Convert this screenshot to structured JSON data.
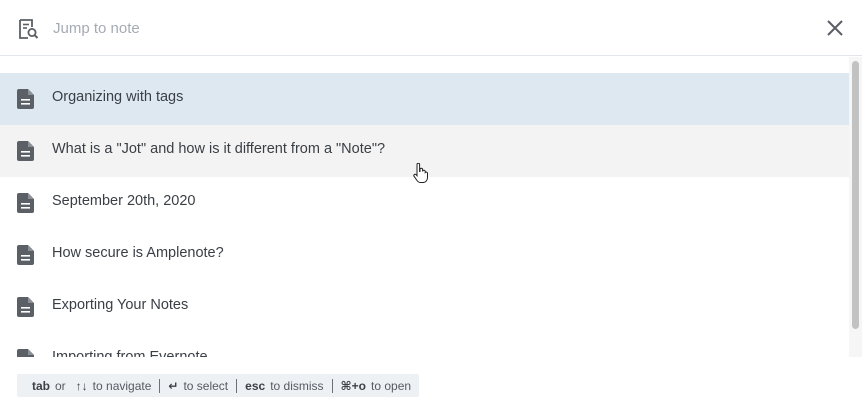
{
  "search": {
    "placeholder": "Jump to note",
    "value": ""
  },
  "icons": {
    "search": "note-search-icon",
    "close": "close-icon",
    "note": "document-icon"
  },
  "notes": [
    {
      "title": "Organizing with tags",
      "state": "selected"
    },
    {
      "title": "What is a \"Jot\" and how is it different from a \"Note\"?",
      "state": "hover"
    },
    {
      "title": "September 20th, 2020",
      "state": "normal"
    },
    {
      "title": "How secure is Amplenote?",
      "state": "normal"
    },
    {
      "title": "Exporting Your Notes",
      "state": "normal"
    },
    {
      "title": "Importing from Evernote",
      "state": "normal"
    }
  ],
  "hints": {
    "tab_key": "tab",
    "or": "or",
    "arrows_key": "↑↓",
    "navigate": "to navigate",
    "enter_key": "↵",
    "select": "to select",
    "esc_key": "esc",
    "dismiss": "to dismiss",
    "open_key": "⌘+o",
    "open": "to open"
  },
  "colors": {
    "selected_row": "#dee8f1",
    "hover_row": "#f3f3f3",
    "hint_bar": "#eef1f4"
  }
}
